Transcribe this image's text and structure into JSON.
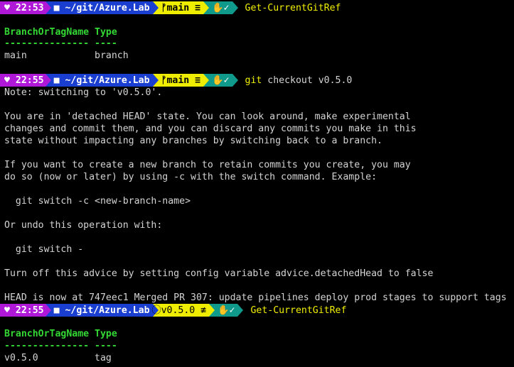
{
  "prompts": [
    {
      "time": "♥ 22:53",
      "path": "■ ~/git/Azure.Lab",
      "git": "ᚠmain ≡",
      "shell_icon": "powershell-icon",
      "shell_glyph": "✋✓",
      "command": "Get-CurrentGitRef",
      "args": ""
    },
    {
      "time": "♥ 22:55",
      "path": "■ ~/git/Azure.Lab",
      "git": "ᚠmain ≡",
      "shell_icon": "powershell-icon",
      "shell_glyph": "✋✓",
      "command": "git",
      "args": " checkout v0.5.0"
    },
    {
      "time": "♥ 22:55",
      "path": "■ ~/git/Azure.Lab",
      "git": "⃝v0.5.0 ≢",
      "shell_icon": "powershell-icon",
      "shell_glyph": "✋✓",
      "command": "Get-CurrentGitRef",
      "args": ""
    }
  ],
  "table1": {
    "header": "BranchOrTagName Type",
    "divider": "--------------- ----",
    "row": "main            branch"
  },
  "output": [
    "Note: switching to 'v0.5.0'.",
    "",
    "You are in 'detached HEAD' state. You can look around, make experimental",
    "changes and commit them, and you can discard any commits you make in this",
    "state without impacting any branches by switching back to a branch.",
    "",
    "If you want to create a new branch to retain commits you create, you may",
    "do so (now or later) by using -c with the switch command. Example:",
    "",
    "  git switch -c <new-branch-name>",
    "",
    "Or undo this operation with:",
    "",
    "  git switch -",
    "",
    "Turn off this advice by setting config variable advice.detachedHead to false",
    "",
    "HEAD is now at 747eec1 Merged PR 307: update pipelines deploy prod stages to support tags"
  ],
  "table2": {
    "header": "BranchOrTagName Type",
    "divider": "--------------- ----",
    "row": "v0.5.0          tag"
  },
  "colors": {
    "time_bg": "#b018d8",
    "path_bg": "#1a3fd0",
    "git_bg": "#f0ee00",
    "shell_bg": "#0f9a8c",
    "header_green": "#34d834",
    "command_yellow": "#f0ee00"
  }
}
